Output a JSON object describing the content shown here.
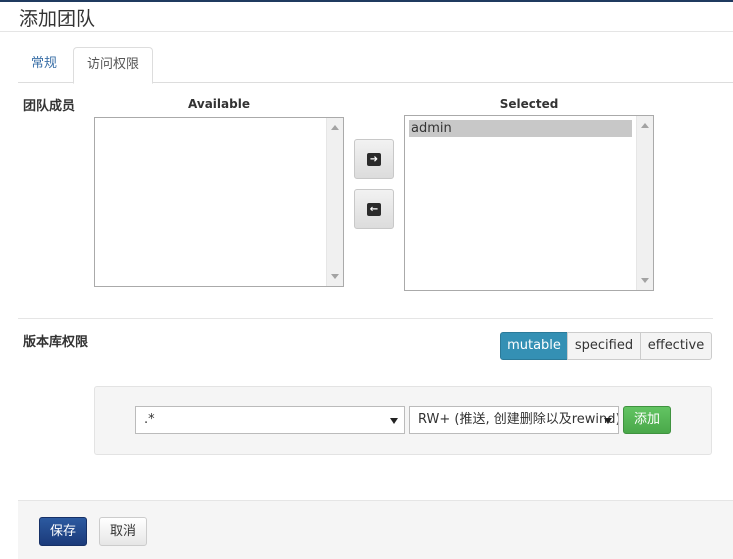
{
  "page": {
    "title": "添加团队"
  },
  "tabs": [
    {
      "label": "常规"
    },
    {
      "label": "访问权限"
    }
  ],
  "members": {
    "label": "团队成员",
    "available_heading": "Available",
    "selected_heading": "Selected",
    "available_items": [],
    "selected_items": [
      "admin"
    ],
    "add_icon": "arrow-right-icon",
    "remove_icon": "arrow-left-icon"
  },
  "repo_permissions": {
    "label": "版本库权限",
    "modes": [
      "mutable",
      "specified",
      "effective"
    ],
    "active_mode": "mutable",
    "repo_value": ".*",
    "permission_value": "RW+ (推送, 创建删除以及rewind)",
    "add_label": "添加"
  },
  "footer": {
    "save_label": "保存",
    "cancel_label": "取消"
  },
  "colors": {
    "accent": "#3490b4",
    "primary": "#1b3a7a",
    "success": "#4aa84a"
  }
}
